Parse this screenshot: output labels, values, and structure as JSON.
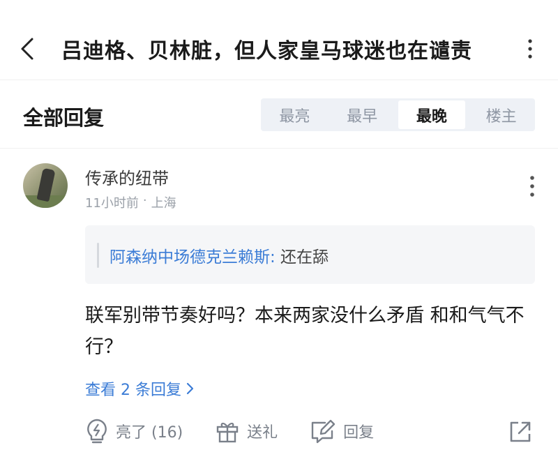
{
  "header": {
    "title": "吕迪格、贝林脏，但人家皇马球迷也在谴责"
  },
  "section": {
    "title": "全部回复",
    "sort_tabs": [
      "最亮",
      "最早",
      "最晚",
      "楼主"
    ],
    "active_sort": "最晚"
  },
  "comment": {
    "username": "传承的纽带",
    "time": "11小时前",
    "dot": "·",
    "location": "上海",
    "quote": {
      "author": "阿森纳中场德克兰赖斯:",
      "text": " 还在舔"
    },
    "content": "联军别带节奏好吗？本来两家没什么矛盾 和和气气不行？",
    "view_replies": "查看 2 条回复",
    "actions": {
      "light_label": "亮了 (16)",
      "gift_label": "送礼",
      "reply_label": "回复"
    }
  },
  "icons": {
    "back": "chevron-left-icon",
    "more": "more-vertical-icon",
    "light": "lightning-bulb-icon",
    "gift": "gift-icon",
    "reply": "edit-reply-icon",
    "share": "share-icon"
  },
  "colors": {
    "accent": "#3b7cd6",
    "muted": "#9aa0a8",
    "sort_bg": "#eef1f6"
  }
}
